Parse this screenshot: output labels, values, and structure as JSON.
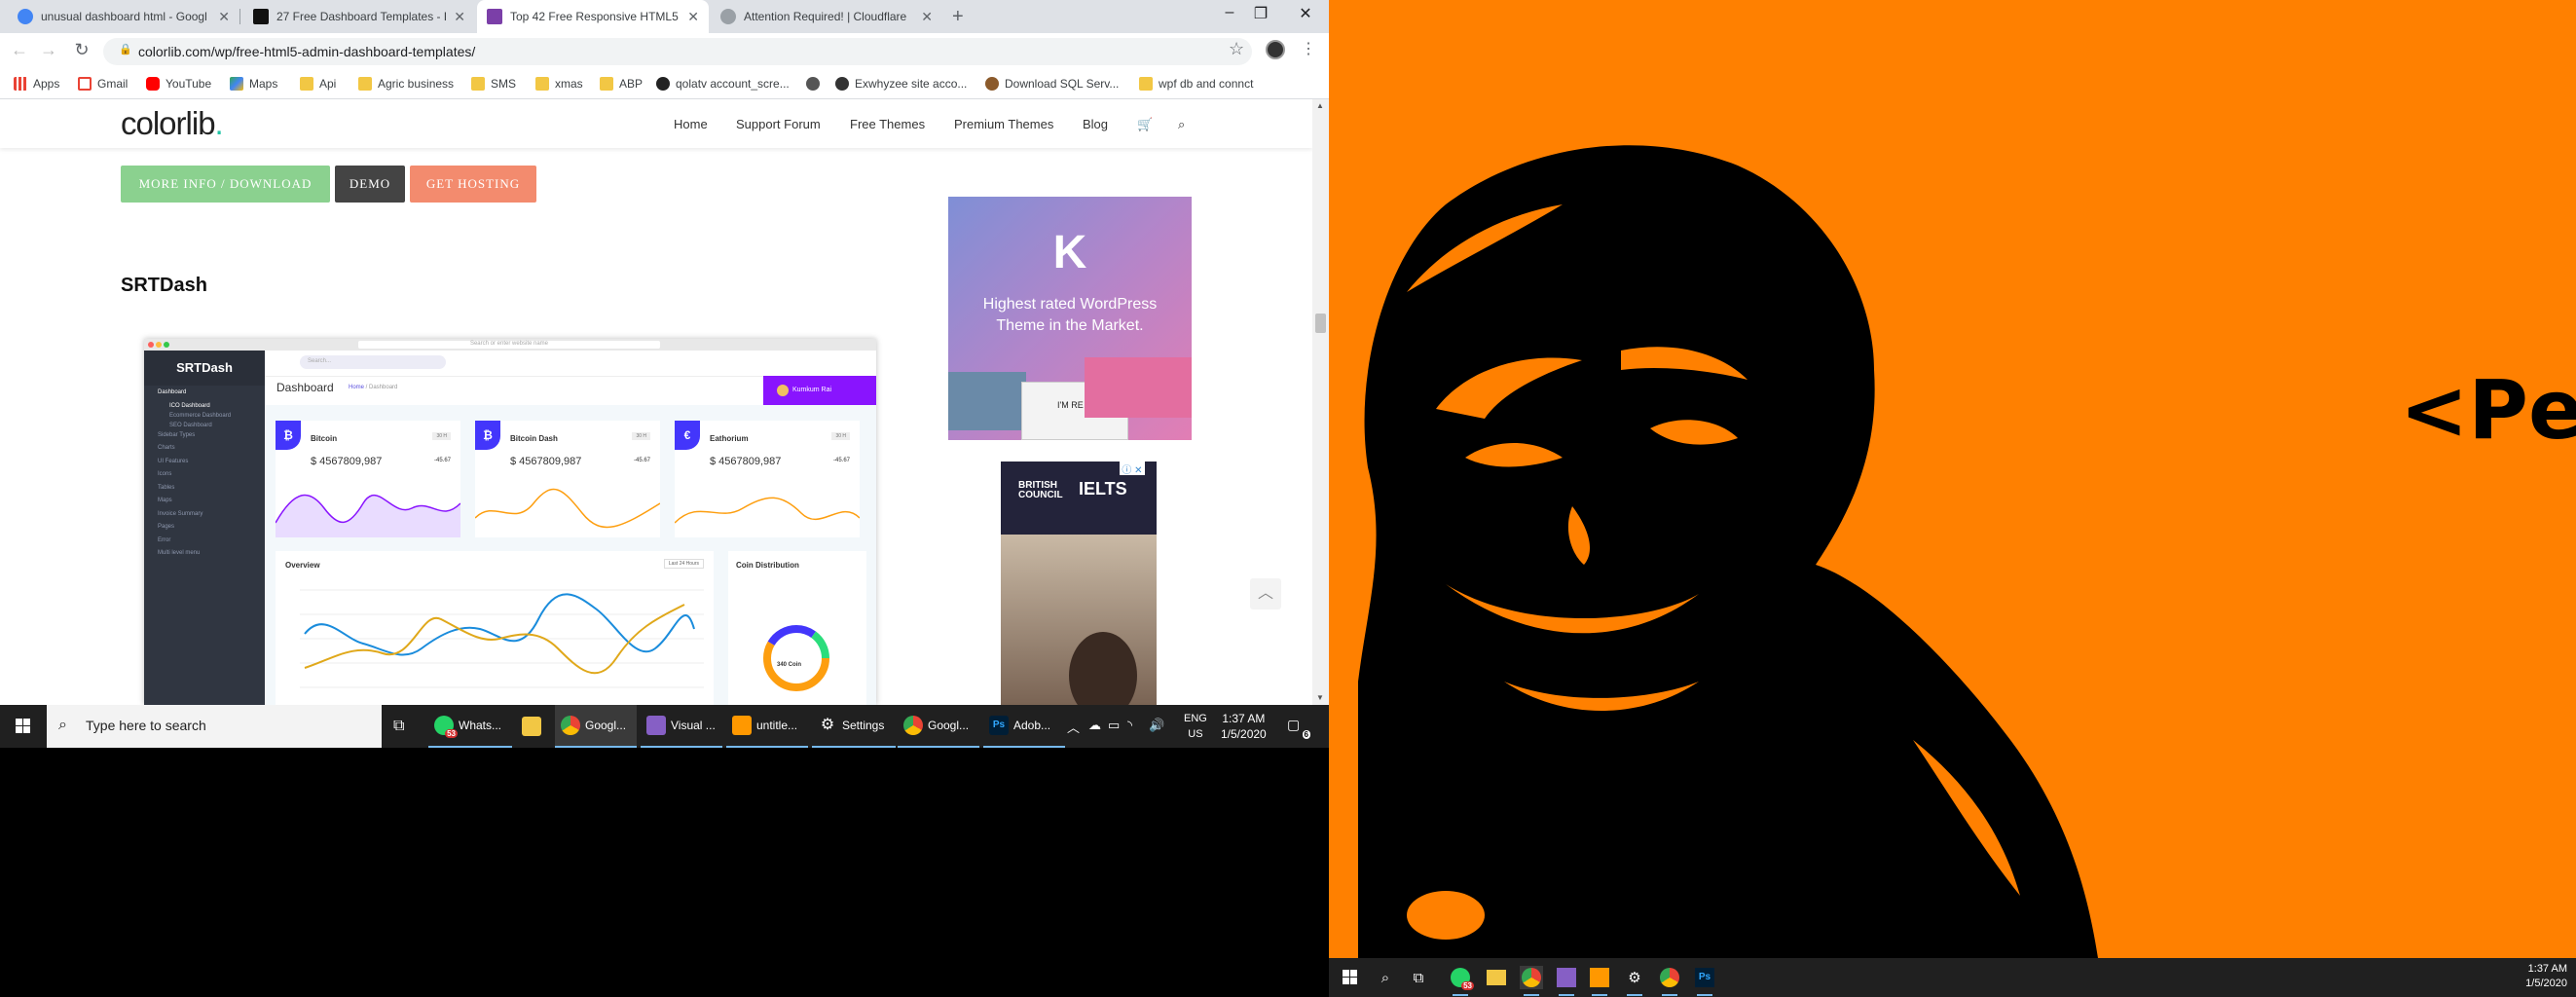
{
  "browser": {
    "tabs": [
      {
        "title": "unusual dashboard html - Googl",
        "favicon_color": "#4285f4"
      },
      {
        "title": "27 Free Dashboard Templates - F",
        "favicon_color": "#111111"
      },
      {
        "title": "Top 42 Free Responsive HTML5 A",
        "favicon_color": "#7b3fa8"
      },
      {
        "title": "Attention Required! | Cloudflare",
        "favicon_color": "#9aa0a6"
      }
    ],
    "active_tab": 2,
    "url": "colorlib.com/wp/free-html5-admin-dashboard-templates/",
    "bookmarks": [
      {
        "label": "Apps",
        "icon": "apps-grid-icon"
      },
      {
        "label": "Gmail",
        "icon": "gmail-icon"
      },
      {
        "label": "YouTube",
        "icon": "youtube-icon"
      },
      {
        "label": "Maps",
        "icon": "maps-icon"
      },
      {
        "label": "Api",
        "icon": "folder-icon"
      },
      {
        "label": "Agric business",
        "icon": "folder-icon"
      },
      {
        "label": "SMS",
        "icon": "folder-icon"
      },
      {
        "label": "xmas",
        "icon": "folder-icon"
      },
      {
        "label": "ABP",
        "icon": "folder-icon"
      },
      {
        "label": "qolatv account_scre...",
        "icon": "site-icon"
      },
      {
        "label": "",
        "icon": "globe-icon"
      },
      {
        "label": "Exwhyzee site acco...",
        "icon": "site-icon"
      },
      {
        "label": "Download SQL Serv...",
        "icon": "site-icon"
      },
      {
        "label": "wpf db and connct",
        "icon": "folder-icon"
      }
    ]
  },
  "site": {
    "logo_text": "colorlib",
    "logo_dot": ".",
    "nav": [
      "Home",
      "Support Forum",
      "Free Themes",
      "Premium Themes",
      "Blog"
    ],
    "buttons": {
      "more_info": "MORE INFO / DOWNLOAD",
      "demo": "DEMO",
      "hosting": "GET HOSTING"
    },
    "section_title": "SRTDash",
    "ad1": {
      "logo": "K",
      "text": "Highest rated WordPress Theme in the Market.",
      "img_text": "I'M RE"
    },
    "ad2": {
      "brand_line1": "BRITISH",
      "brand_line2": "COUNCIL",
      "product": "IELTS"
    }
  },
  "dashboard_preview": {
    "logo": "SRTDash",
    "url_hint": "Search or enter website name",
    "search_placeholder": "Search...",
    "title": "Dashboard",
    "crumb_home": "Home",
    "crumb_current": " / Dashboard",
    "user": "Kumkum Rai",
    "sidebar": [
      {
        "label": "Dashboard",
        "active": true,
        "sub": false
      },
      {
        "label": "ICO Dashboard",
        "active": true,
        "sub": true
      },
      {
        "label": "Ecommerce Dashboard",
        "active": false,
        "sub": true
      },
      {
        "label": "SEO Dashboard",
        "active": false,
        "sub": true
      },
      {
        "label": "Sidebar Types",
        "active": false,
        "sub": false
      },
      {
        "label": "Charts",
        "active": false,
        "sub": false
      },
      {
        "label": "UI Features",
        "active": false,
        "sub": false
      },
      {
        "label": "Icons",
        "active": false,
        "sub": false
      },
      {
        "label": "Tables",
        "active": false,
        "sub": false
      },
      {
        "label": "Maps",
        "active": false,
        "sub": false
      },
      {
        "label": "Invoice Summary",
        "active": false,
        "sub": false
      },
      {
        "label": "Pages",
        "active": false,
        "sub": false
      },
      {
        "label": "Error",
        "active": false,
        "sub": false
      },
      {
        "label": "Multi level menu",
        "active": false,
        "sub": false
      }
    ],
    "cards": [
      {
        "icon": "₿",
        "name": "Bitcoin",
        "badge": "30 H",
        "price": "$ 4567809,987",
        "change": "-45.67",
        "color": "#8914fe"
      },
      {
        "icon": "₿",
        "name": "Bitcoin Dash",
        "badge": "30 H",
        "price": "$ 4567809,987",
        "change": "-45.67",
        "color": "#fd9e0f"
      },
      {
        "icon": "€",
        "name": "Eathorium",
        "badge": "30 H",
        "price": "$ 4567809,987",
        "change": "-45.67",
        "color": "#fd9e0f"
      }
    ],
    "overview_title": "Overview",
    "overview_select": "Last 24 Hours",
    "coin_title": "Coin Distribution",
    "coin_center": "340 Coin"
  },
  "taskbar": {
    "search_placeholder": "Type here to search",
    "apps": [
      {
        "label": "Whats...",
        "icon": "whatsapp-icon",
        "color": "#25d366",
        "badge": "53"
      },
      {
        "label": "",
        "icon": "file-explorer-icon",
        "color": "#f2c744"
      },
      {
        "label": "Googl...",
        "icon": "chrome-icon",
        "color": "#4285f4",
        "active": true
      },
      {
        "label": "Visual ...",
        "icon": "visual-studio-icon",
        "color": "#865fc5"
      },
      {
        "label": "untitle...",
        "icon": "sublime-icon",
        "color": "#ff9800"
      },
      {
        "label": "Settings",
        "icon": "settings-icon",
        "color": "#888888"
      },
      {
        "label": "Googl...",
        "icon": "chrome-icon",
        "color": "#4285f4"
      },
      {
        "label": "Adob...",
        "icon": "photoshop-icon",
        "color": "#001e36"
      }
    ],
    "lang": "ENG",
    "region": "US",
    "time": "1:37 AM",
    "date": "1/5/2020",
    "notif_count": "6"
  },
  "second_monitor": {
    "wallpaper_text": "<Pe",
    "time": "1:37 AM",
    "date": "1/5/2020",
    "whatsapp_badge": "53"
  }
}
